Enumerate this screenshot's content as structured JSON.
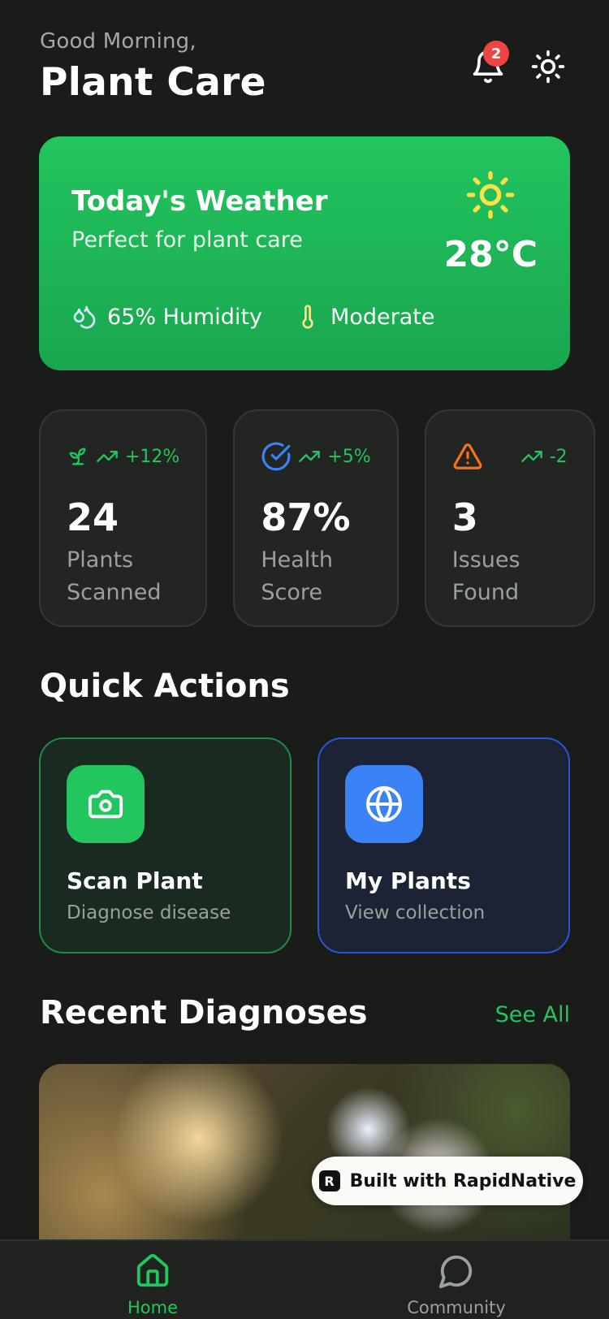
{
  "header": {
    "greeting": "Good Morning,",
    "title": "Plant Care",
    "notification_count": "2",
    "icons": [
      "bell-icon",
      "sun-theme-icon"
    ]
  },
  "weather": {
    "title": "Today's Weather",
    "subtitle": "Perfect for plant care",
    "temperature": "28°C",
    "humidity": "65% Humidity",
    "condition": "Moderate",
    "icons": [
      "sun-icon",
      "droplets-icon",
      "thermometer-icon"
    ]
  },
  "stats": [
    {
      "icon": "sprout-icon",
      "trend": "+12%",
      "value": "24",
      "label": "Plants Scanned",
      "icon_color": "#22c55e"
    },
    {
      "icon": "check-circle-icon",
      "trend": "+5%",
      "value": "87%",
      "label": "Health Score",
      "icon_color": "#3b82f6"
    },
    {
      "icon": "warning-icon",
      "trend": "-2",
      "value": "3",
      "label": "Issues Found",
      "icon_color": "#f97316"
    }
  ],
  "quick_actions": {
    "title": "Quick Actions",
    "items": [
      {
        "icon": "camera-icon",
        "title": "Scan Plant",
        "subtitle": "Diagnose disease",
        "color": "#22c55e"
      },
      {
        "icon": "globe-icon",
        "title": "My Plants",
        "subtitle": "View collection",
        "color": "#3b82f6"
      }
    ]
  },
  "recent": {
    "title": "Recent Diagnoses",
    "see_all": "See All"
  },
  "built_with": "Built with RapidNative",
  "tabs": [
    {
      "label": "Home",
      "icon": "home-icon",
      "active": true
    },
    {
      "label": "Community",
      "icon": "chat-bubble-icon",
      "active": false
    }
  ],
  "colors": {
    "background": "#1a1c1a",
    "accent_green": "#22c55e",
    "accent_blue": "#3b82f6",
    "accent_orange": "#f97316",
    "badge_red": "#ef4444"
  }
}
